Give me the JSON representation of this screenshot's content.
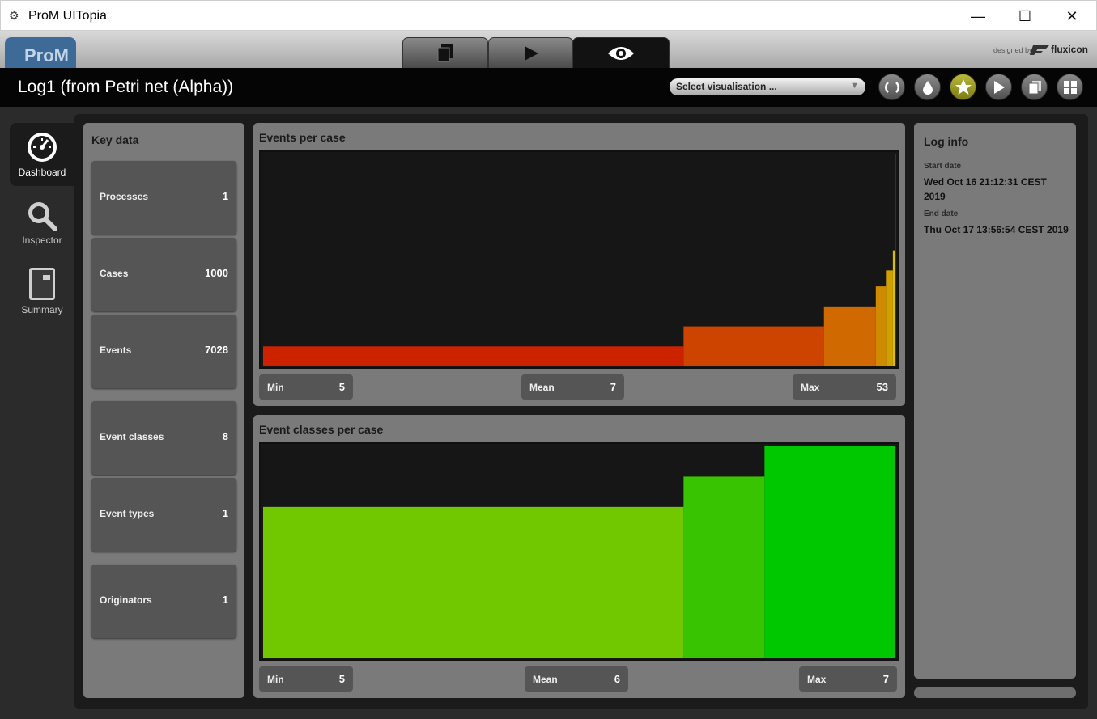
{
  "window": {
    "title": "ProM UITopia",
    "minimize": "—",
    "maximize": "☐",
    "close": "✕"
  },
  "topstrip": {
    "logo": "ProM",
    "designed_by": "designed by",
    "brand": "fluxicon"
  },
  "header": {
    "log_title": "Log1 (from Petri net (Alpha))",
    "select_placeholder": "Select visualisation ...",
    "select_arrow": "▼"
  },
  "nav": [
    {
      "label": "Dashboard",
      "icon": "gauge-icon"
    },
    {
      "label": "Inspector",
      "icon": "magnifier-icon"
    },
    {
      "label": "Summary",
      "icon": "notebook-icon"
    }
  ],
  "key_data": {
    "title": "Key data",
    "items": [
      {
        "label": "Processes",
        "value": "1"
      },
      {
        "label": "Cases",
        "value": "1000"
      },
      {
        "label": "Events",
        "value": "7028"
      },
      {
        "label": "Event classes",
        "value": "8"
      },
      {
        "label": "Event types",
        "value": "1"
      },
      {
        "label": "Originators",
        "value": "1"
      }
    ]
  },
  "events_per_case": {
    "title": "Events per case",
    "min_label": "Min",
    "min": "5",
    "mean_label": "Mean",
    "mean": "7",
    "max_label": "Max",
    "max": "53"
  },
  "event_classes_per_case": {
    "title": "Event classes per case",
    "min_label": "Min",
    "min": "5",
    "mean_label": "Mean",
    "mean": "6",
    "max_label": "Max",
    "max": "7"
  },
  "log_info": {
    "title": "Log info",
    "start_label": "Start date",
    "start": "Wed Oct 16 21:12:31 CEST 2019",
    "end_label": "End date",
    "end": "Thu Oct 17 13:56:54 CEST 2019"
  },
  "chart_data": [
    {
      "type": "bar",
      "title": "Events per case",
      "note": "cumulative distribution band chart; widths ~ share of cases, heights ~ events per case",
      "bars": [
        {
          "share": 0.665,
          "value": 5,
          "color": "#cc2200"
        },
        {
          "share": 0.222,
          "value": 10,
          "color": "#cc4400"
        },
        {
          "share": 0.082,
          "value": 15,
          "color": "#d06a00"
        },
        {
          "share": 0.016,
          "value": 20,
          "color": "#d08a00"
        },
        {
          "share": 0.011,
          "value": 24,
          "color": "#d0a000"
        },
        {
          "share": 0.003,
          "value": 29,
          "color": "#d8c000"
        },
        {
          "share": 0.001,
          "value": 53,
          "color": "#44cc00"
        }
      ],
      "ymax": 53
    },
    {
      "type": "bar",
      "title": "Event classes per case",
      "note": "cumulative distribution band chart; widths ~ share of cases, heights ~ event classes per case",
      "bars": [
        {
          "share": 0.665,
          "value": 5,
          "color": "#72c800"
        },
        {
          "share": 0.128,
          "value": 6,
          "color": "#38c400"
        },
        {
          "share": 0.207,
          "value": 7,
          "color": "#00c800"
        }
      ],
      "ymax": 7
    }
  ]
}
